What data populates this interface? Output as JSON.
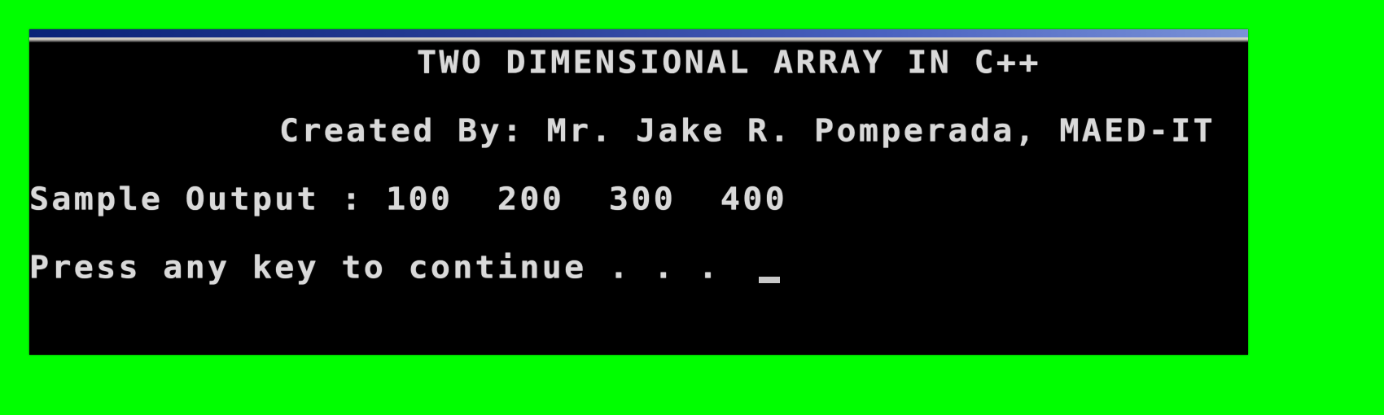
{
  "window": {
    "type": "console",
    "background_color": "#00ff00",
    "console_bg": "#000000",
    "text_color": "#d9d9d9",
    "title_bar_gradient": [
      "#0a2378",
      "#7b93d8"
    ]
  },
  "console": {
    "lines": [
      {
        "id": "title",
        "text": "TWO DIMENSIONAL ARRAY IN C++"
      },
      {
        "id": "author",
        "text": "Created By: Mr. Jake R. Pomperada, MAED-IT"
      },
      {
        "id": "output",
        "text": "Sample Output : 100  200  300  400"
      },
      {
        "id": "prompt",
        "text": "Press any key to continue . . ."
      }
    ],
    "cursor": "underscore"
  }
}
